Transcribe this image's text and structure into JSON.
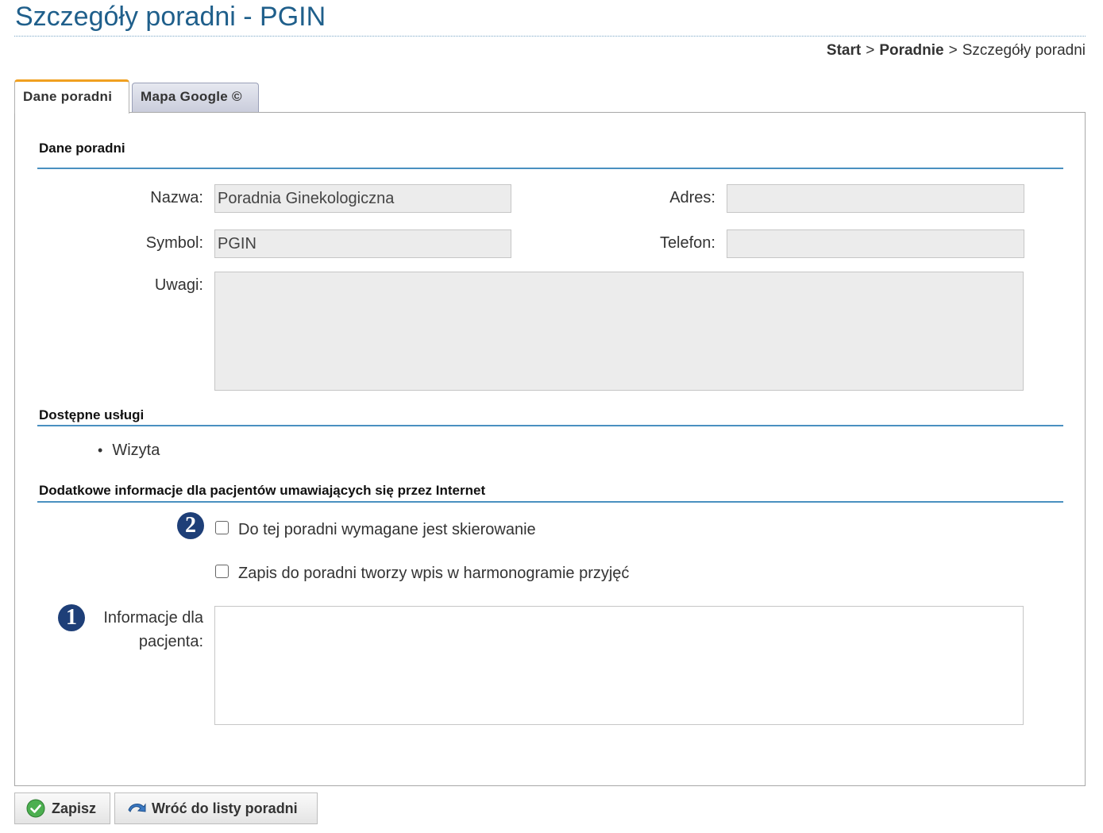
{
  "page": {
    "title": "Szczegóły poradni - PGIN"
  },
  "breadcrumb": {
    "items": [
      "Start",
      "Poradnie",
      "Szczegóły poradni"
    ],
    "separator": ">"
  },
  "tabs": [
    {
      "label": "Dane poradni",
      "active": true
    },
    {
      "label": "Mapa Google ©",
      "active": false
    }
  ],
  "section_main": {
    "title": "Dane poradni",
    "name_label": "Nazwa:",
    "name_value": "Poradnia Ginekologiczna",
    "symbol_label": "Symbol:",
    "symbol_value": "PGIN",
    "address_label": "Adres:",
    "address_value": "",
    "phone_label": "Telefon:",
    "phone_value": "",
    "notes_label": "Uwagi:",
    "notes_value": ""
  },
  "section_services": {
    "title": "Dostępne usługi",
    "items": [
      "Wizyta"
    ]
  },
  "section_extra": {
    "title": "Dodatkowe informacje dla pacjentów umawiających się przez Internet",
    "referral_label": "Do tej poradni wymagane jest skierowanie",
    "referral_checked": false,
    "schedule_label": "Zapis do poradni tworzy wpis w harmonogramie przyjęć",
    "schedule_checked": false,
    "info_label_line1": "Informacje dla",
    "info_label_line2": "pacjenta:",
    "info_value": "",
    "badge_1": "1",
    "badge_2": "2"
  },
  "buttons": {
    "save_label": "Zapisz",
    "back_label": "Wróć do listy poradni"
  },
  "colors": {
    "title": "#1f5f8b",
    "rule": "#4a90c0",
    "badge": "#1e3f78",
    "tab_accent": "#f0a020"
  }
}
